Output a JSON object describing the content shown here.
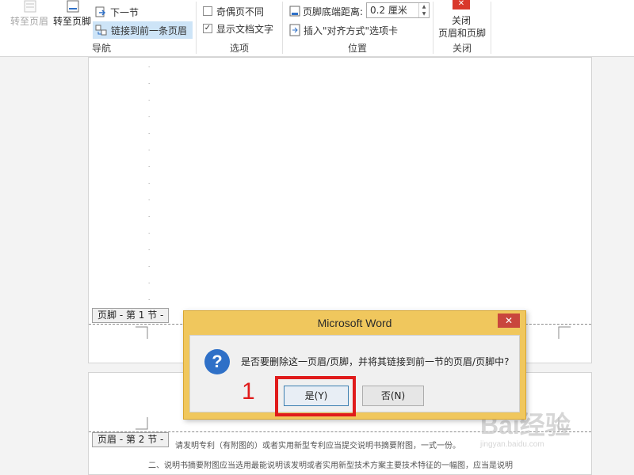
{
  "ribbon": {
    "navigation": {
      "group_label": "导航",
      "goto_header": "转至页眉",
      "goto_footer": "转至页脚",
      "next_section": "下一节",
      "link_previous": "链接到前一条页眉"
    },
    "options": {
      "group_label": "选项",
      "odd_even": "奇偶页不同",
      "odd_even_checked": false,
      "show_doc_text": "显示文档文字",
      "show_doc_text_checked": true
    },
    "position": {
      "group_label": "位置",
      "footer_distance_label": "页脚底端距离:",
      "footer_distance_value": "0.2 厘米",
      "insert_align_tab": "插入\"对齐方式\"选项卡"
    },
    "close": {
      "group_label": "关闭",
      "close_line1": "关闭",
      "close_line2": "页眉和页脚"
    }
  },
  "document": {
    "footer_tag": "页脚 - 第 1 节 -",
    "header_tag": "页眉 - 第 2 节 -",
    "body_line1": "请发明专利（有附图的）或者实用新型专利应当提交说明书摘要附图，一式一份。",
    "body_line2": "二、说明书摘要附图应当选用最能说明该发明或者实用新型技术方案主要技术特征的一幅图，应当是说明"
  },
  "dialog": {
    "title": "Microsoft Word",
    "close_symbol": "✕",
    "icon_symbol": "?",
    "message": "是否要删除这一页眉/页脚，并将其链接到前一节的页眉/页脚中?",
    "yes_label": "是(Y)",
    "no_label": "否(N)"
  },
  "annotation": {
    "step_number": "1",
    "color": "#e01b1b"
  },
  "watermark": {
    "text": "Bai经验",
    "subtext": "jingyan.baidu.com"
  }
}
